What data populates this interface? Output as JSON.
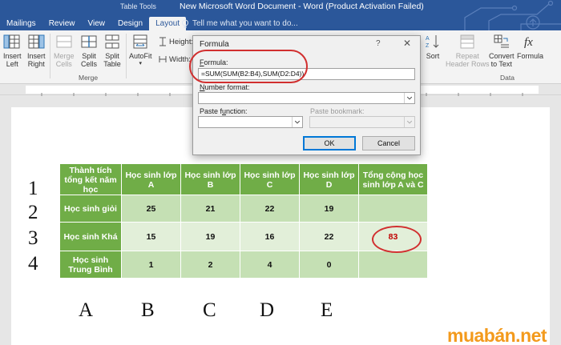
{
  "window": {
    "table_tools_label": "Table Tools",
    "title": "New Microsoft Word Document - Word (Product Activation Failed)",
    "tabs": [
      "Mailings",
      "Review",
      "View",
      "Design",
      "Layout"
    ],
    "active_tab": "Layout",
    "tell_me": "Tell me what you want to do..."
  },
  "ribbon": {
    "insert_left": "Insert\nLeft",
    "insert_right": "Insert\nRight",
    "merge_cells": "Merge\nCells",
    "split_cells": "Split\nCells",
    "split_table": "Split\nTable",
    "autofit": "AutoFit",
    "merge_group": "Merge",
    "height_label": "Height:",
    "width_label": "Width:",
    "sort": "Sort",
    "repeat_header_rows": "Repeat\nHeader Rows",
    "convert_to_text": "Convert\nto Text",
    "formula": "Formula",
    "data_group": "Data"
  },
  "dialog": {
    "title": "Formula",
    "help": "?",
    "close": "✕",
    "formula_label_u": "F",
    "formula_label_rest": "ormula:",
    "formula_value": "=SUM(SUM(B2:B4),SUM(D2:D4))",
    "number_format_label_u": "N",
    "number_format_label_rest": "umber format:",
    "number_format_value": "",
    "paste_function_label_pre": "Paste f",
    "paste_function_label_u": "u",
    "paste_function_label_rest": "nction:",
    "paste_bookmark_label": "Paste bookmark:",
    "ok": "OK",
    "cancel": "Cancel"
  },
  "document": {
    "row_numbers": [
      "1",
      "2",
      "3",
      "4"
    ],
    "column_letters": [
      "A",
      "B",
      "C",
      "D",
      "E"
    ],
    "table": {
      "headers": [
        "Thành tích tổng kết năm học",
        "Học sinh lớp A",
        "Học sinh lớp B",
        "Học sinh lớp C",
        "Học sinh lớp D",
        "Tổng cộng học sinh lớp A và C"
      ],
      "rows": [
        {
          "label": "Học sinh giỏi",
          "values": [
            "25",
            "21",
            "22",
            "19",
            ""
          ]
        },
        {
          "label": "Học sinh Khá",
          "values": [
            "15",
            "19",
            "16",
            "22",
            "83"
          ]
        },
        {
          "label": "Học sinh Trung Bình",
          "values": [
            "1",
            "2",
            "4",
            "0",
            ""
          ]
        }
      ]
    }
  },
  "watermark": "muabán.net",
  "colors": {
    "word_blue": "#2b579a",
    "table_green": "#70ad47",
    "cell_light": "#e2efd9",
    "cell_mid": "#c5e0b4",
    "highlight_red": "#d12f2f",
    "watermark_orange": "#f39a1c"
  }
}
